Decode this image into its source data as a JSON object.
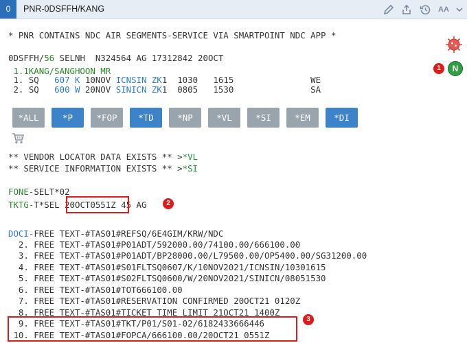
{
  "window": {
    "tab_number": "0",
    "title": "PNR-0DSFFH/KANG",
    "aa_label": "AA"
  },
  "pnr": {
    "ndc_notice": "* PNR CONTAINS NDC AIR SEGMENTS-SERVICE VIA SMARTPOINT NDC APP *",
    "header": {
      "record_locator": "0DSFFH",
      "slash": "/",
      "agent_id": "56",
      "rest": " SELNH  N324564 AG 17312842 20OCT"
    },
    "passenger": " 1.1KANG/SANGHOON MR",
    "segments": [
      {
        "num": " 1.",
        "carrier": " SQ  ",
        "flight": " 607",
        "cls": " K",
        "date": " 10NOV ",
        "route": "ICNSIN",
        "status": " ZK",
        "rest": "1  1030   1615               WE"
      },
      {
        "num": " 2.",
        "carrier": " SQ  ",
        "flight": " 600",
        "cls": " W",
        "date": " 20NOV ",
        "route": "SINICN",
        "status": " ZK",
        "rest": "1  0805   1530               SA"
      }
    ],
    "buttons": [
      "*ALL",
      "*P",
      "*FOP",
      "*TD",
      "*NP",
      "*VL",
      "*SI",
      "*EM",
      "*DI"
    ],
    "vendor_notice": {
      "text": "** VENDOR LOCATOR DATA EXISTS ** >",
      "link": "*VL"
    },
    "service_notice": {
      "text": "** SERVICE INFORMATION EXISTS ** >",
      "link": "*SI"
    },
    "fone": {
      "label": "FONE-",
      "value": "SELT*02"
    },
    "tktg": {
      "label": "TKTG-",
      "prefix": "T*SEL ",
      "time": "20OCT0551Z",
      "suffix": " 45 AG"
    },
    "doci_label": "DOCI-",
    "free_text": [
      "FREE TEXT-#TAS01#REFSQ/6E4GIM/KRW/NDC",
      "  2. FREE TEXT-#TAS01#P01ADT/592000.00/74100.00/666100.00",
      "  3. FREE TEXT-#TAS01#P01ADT/BP28000.00/L79500.00/OP5400.00/SG31200.00",
      "  4. FREE TEXT-#TAS01#S01FLTSQ0607/K/10NOV2021/ICNSIN/10301615",
      "  5. FREE TEXT-#TAS01#S02FLTSQ0600/W/20NOV2021/SINICN/08051530",
      "  6. FREE TEXT-#TAS01#TOT666100.00",
      "  7. FREE TEXT-#TAS01#RESERVATION CONFIRMED 20OCT21 0120Z",
      "  8. FREE TEXT-#TAS01#TICKET TIME LIMIT 21OCT21 1400Z",
      "  9. FREE TEXT-#TAS01#TKT/P01/S01-02/6182433666446",
      " 10. FREE TEXT-#TAS01#FOPCA/666100.00/20OCT21 0551Z"
    ],
    "ndc_badge": "N",
    "annotations": [
      "1",
      "2",
      "3"
    ]
  }
}
